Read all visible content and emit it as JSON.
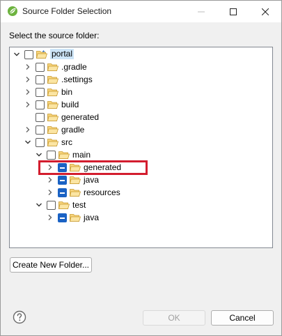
{
  "window": {
    "title": "Source Folder Selection",
    "icon": "eclipse-spring-icon",
    "controls": {
      "minimize": "minimize-icon",
      "maximize": "maximize-icon",
      "close": "close-icon"
    }
  },
  "prompt": "Select the source folder:",
  "tree": {
    "nodes": [
      {
        "label": "portal",
        "checked": "unchecked",
        "expanded": true,
        "selected": true
      },
      {
        "label": ".gradle",
        "checked": "unchecked",
        "expanded": false
      },
      {
        "label": ".settings",
        "checked": "unchecked",
        "expanded": false
      },
      {
        "label": "bin",
        "checked": "unchecked",
        "expanded": false
      },
      {
        "label": "build",
        "checked": "unchecked",
        "expanded": false
      },
      {
        "label": "generated",
        "checked": "unchecked"
      },
      {
        "label": "gradle",
        "checked": "unchecked",
        "expanded": false
      },
      {
        "label": "src",
        "checked": "unchecked",
        "expanded": true
      },
      {
        "label": "main",
        "checked": "unchecked",
        "expanded": true
      },
      {
        "label": "generated",
        "checked": "partial",
        "expanded": false,
        "highlighted": true
      },
      {
        "label": "java",
        "checked": "partial",
        "expanded": false
      },
      {
        "label": "resources",
        "checked": "partial",
        "expanded": false
      },
      {
        "label": "test",
        "checked": "unchecked",
        "expanded": true
      },
      {
        "label": "java",
        "checked": "partial",
        "expanded": false
      }
    ]
  },
  "buttons": {
    "create_folder": "Create New Folder...",
    "ok": "OK",
    "cancel": "Cancel",
    "ok_enabled": false
  },
  "help_icon": "help-icon",
  "colors": {
    "highlight_border": "#d31d2e",
    "checkbox_partial": "#1a62c4",
    "selection_bg": "#cce4f7"
  }
}
